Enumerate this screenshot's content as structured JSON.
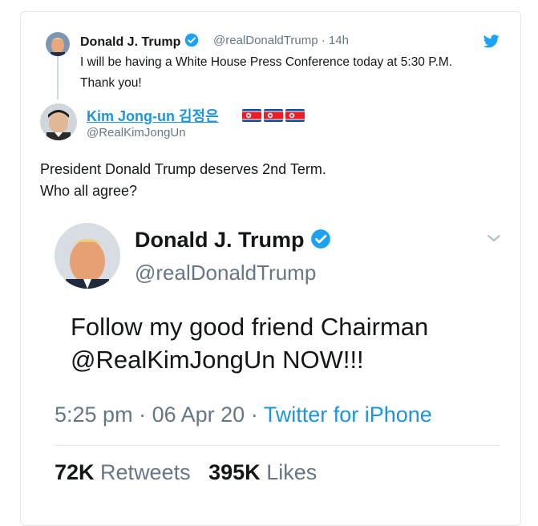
{
  "reply_tweet": {
    "author_name": "Donald J. Trump",
    "author_handle": "@realDonaldTrump",
    "separator": "·",
    "time": "14h",
    "text": "I will be having a White House Press Conference today at 5:30 P.M. Thank you!",
    "verified": true,
    "icon": "twitter-bird-icon"
  },
  "main_tweet": {
    "author_name": "Kim Jong-un 김정은",
    "author_handle": "@RealKimJongUn",
    "flags": [
      "north-korea-flag",
      "north-korea-flag",
      "north-korea-flag"
    ],
    "text_line1": "President Donald Trump deserves 2nd Term.",
    "text_line2": "Who all agree?"
  },
  "embedded_tweet": {
    "author_name": "Donald J. Trump",
    "author_handle": "@realDonaldTrump",
    "text_line1": "Follow my good friend Chairman",
    "text_line2": "@RealKimJongUn NOW!!!",
    "time": "5:25 pm",
    "date": "06 Apr 20",
    "separator": "·",
    "source": "Twitter for iPhone",
    "retweets_count": "72K",
    "retweets_label": "Retweets",
    "likes_count": "395K",
    "likes_label": "Likes"
  },
  "colors": {
    "twitter_blue": "#1da1f2",
    "link_blue": "#1b95e0",
    "muted_gray": "#657786",
    "border": "#e1e8ed"
  }
}
